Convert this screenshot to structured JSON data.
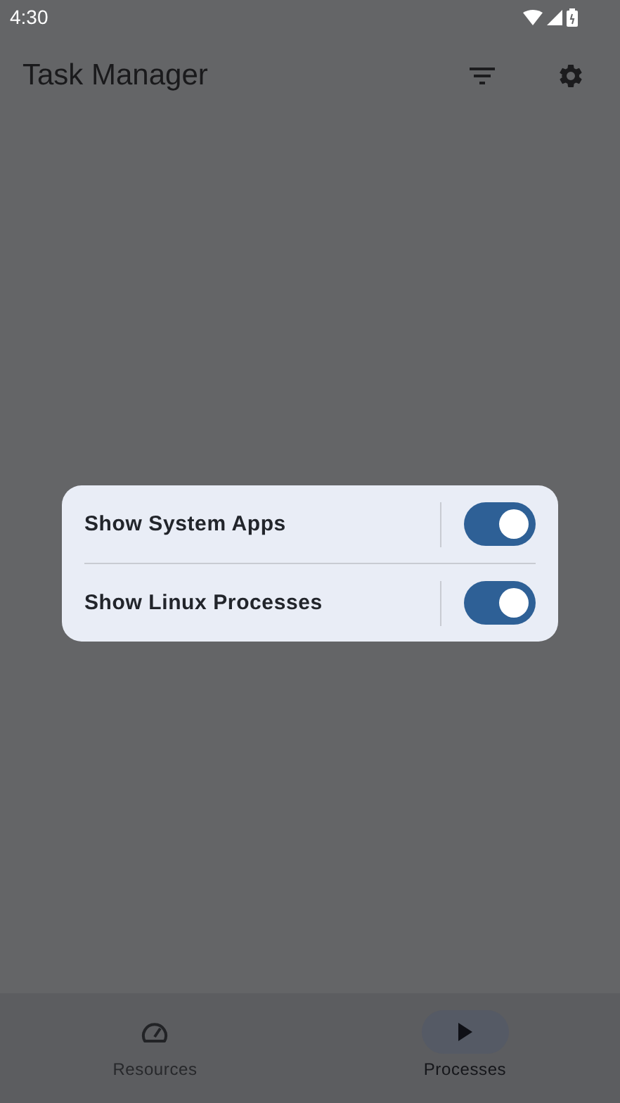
{
  "status_bar": {
    "time": "4:30"
  },
  "app_bar": {
    "title": "Task Manager"
  },
  "dialog": {
    "options": [
      {
        "label": "Show System Apps",
        "on": true
      },
      {
        "label": "Show Linux Processes",
        "on": true
      }
    ]
  },
  "bottom_nav": [
    {
      "label": "Resources",
      "selected": false
    },
    {
      "label": "Processes",
      "selected": true
    }
  ]
}
